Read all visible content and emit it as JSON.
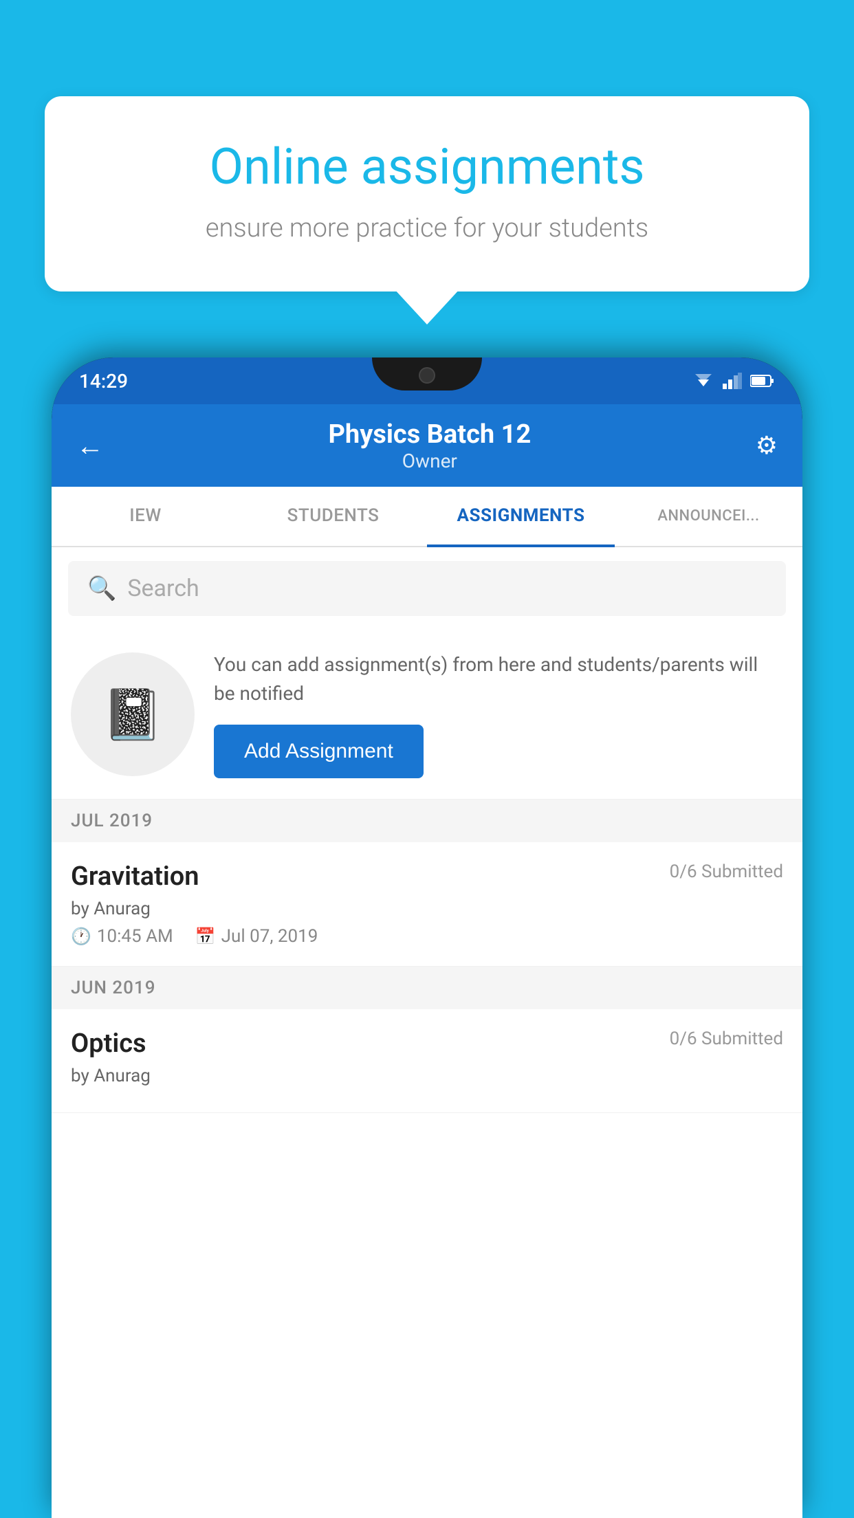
{
  "background_color": "#1ab8e8",
  "speech_bubble": {
    "title": "Online assignments",
    "subtitle": "ensure more practice for your students"
  },
  "status_bar": {
    "time": "14:29"
  },
  "app_bar": {
    "title": "Physics Batch 12",
    "subtitle": "Owner",
    "back_label": "←",
    "settings_label": "⚙"
  },
  "tabs": [
    {
      "label": "IEW",
      "active": false
    },
    {
      "label": "STUDENTS",
      "active": false
    },
    {
      "label": "ASSIGNMENTS",
      "active": true
    },
    {
      "label": "ANNOUNCEM…",
      "active": false
    }
  ],
  "search": {
    "placeholder": "Search"
  },
  "promo": {
    "description": "You can add assignment(s) from here and students/parents will be notified",
    "button_label": "Add Assignment"
  },
  "assignments": [
    {
      "month_header": "JUL 2019",
      "title": "Gravitation",
      "submitted": "0/6 Submitted",
      "by": "by Anurag",
      "time": "10:45 AM",
      "date": "Jul 07, 2019"
    },
    {
      "month_header": "JUN 2019",
      "title": "Optics",
      "submitted": "0/6 Submitted",
      "by": "by Anurag",
      "time": "",
      "date": ""
    }
  ]
}
